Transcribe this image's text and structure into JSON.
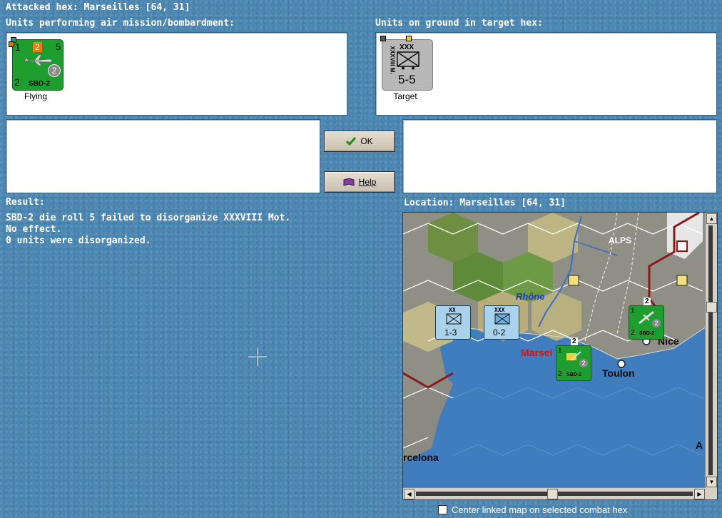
{
  "header": {
    "attacked_hex": "Attacked hex: Marseilles  [64, 31]"
  },
  "left_panel": {
    "title": "Units performing air mission/bombardment:",
    "unit": {
      "top_left": "1",
      "top_mid": "2",
      "top_right": "5",
      "bottom_left": "2",
      "name": "SBD-2",
      "circle": "2",
      "status": "Flying"
    }
  },
  "right_panel": {
    "title": "Units on ground in target hex:",
    "unit": {
      "size": "XXX",
      "side_label": "XXXVIII M.",
      "strength": "5-5",
      "status": "Target"
    }
  },
  "buttons": {
    "ok": "OK",
    "help": "Help"
  },
  "result": {
    "label": "Result:",
    "lines": [
      "SBD-2 die roll 5 failed to disorganize XXXVIII Mot.",
      "No effect.",
      "0 units were disorganized."
    ]
  },
  "location": {
    "label": "Location:  Marseilles  [64, 31]"
  },
  "map": {
    "labels": {
      "alps": "ALPS",
      "rhone": "Rhône",
      "marseilles": "Marsei",
      "toulon": "Toulon",
      "nice": "Nice",
      "barcelona": "rcelona",
      "edge_a": "A"
    },
    "units": [
      {
        "size": "XX",
        "strength": "1-3"
      },
      {
        "size": "XXX",
        "strength": "0-2"
      }
    ],
    "air_units": [
      {
        "name": "SBD-2",
        "top": "2",
        "left": "1",
        "bottom": "2",
        "circle": "2"
      },
      {
        "name": "SBD-2",
        "top": "2",
        "left": "1",
        "bottom": "2",
        "circle": "2"
      }
    ]
  },
  "footer": {
    "checkbox_label": "Center linked map on selected combat hex"
  }
}
